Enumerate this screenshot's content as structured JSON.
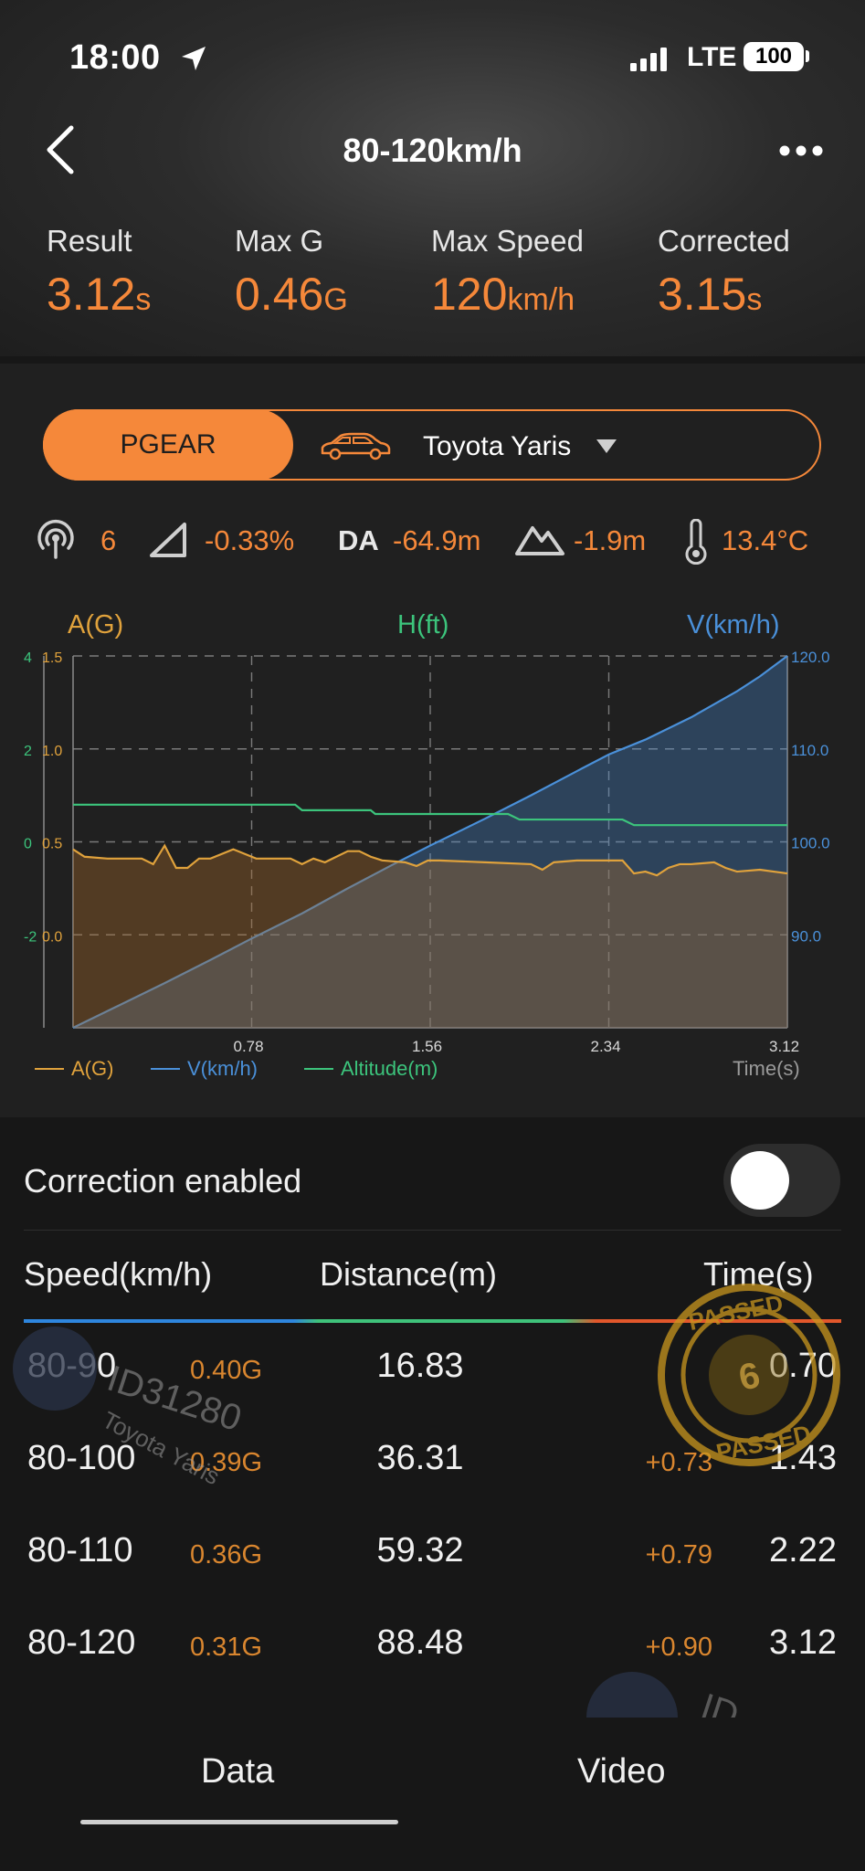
{
  "status_bar": {
    "time": "18:00",
    "network": "LTE",
    "battery": "100"
  },
  "nav": {
    "title": "80-120km/h"
  },
  "metrics": [
    {
      "label": "Result",
      "value": "3.12",
      "unit": "s"
    },
    {
      "label": "Max G",
      "value": "0.46",
      "unit": "G"
    },
    {
      "label": "Max Speed",
      "value": "120",
      "unit": "km/h"
    },
    {
      "label": "Corrected",
      "value": "3.15",
      "unit": "s"
    }
  ],
  "selector": {
    "active_tab": "PGEAR",
    "car": "Toyota Yaris"
  },
  "env": {
    "satellites": "6",
    "slope": "-0.33%",
    "da_label": "DA",
    "da": "-64.9m",
    "altitude": "-1.9m",
    "temperature": "13.4°C"
  },
  "chart_data": {
    "type": "line",
    "axis_titles": {
      "left": "A(G)",
      "middle": "H(ft)",
      "right": "V(km/h)"
    },
    "x_label": "Time(s)",
    "x_ticks": [
      "0.78",
      "1.56",
      "2.34",
      "3.12"
    ],
    "xlim": [
      0,
      3.12
    ],
    "left_ticks_h": [
      "4",
      "2",
      "0",
      "-2"
    ],
    "left_ticks_a": [
      "1.5",
      "1.0",
      "0.5",
      "0.0"
    ],
    "right_ticks": [
      "120.0",
      "110.0",
      "100.0",
      "90.0"
    ],
    "legend": [
      "A(G)",
      "V(km/h)",
      "Altitude(m)"
    ],
    "colors": {
      "accel": "#e0a23c",
      "speed": "#4a90d9",
      "altitude": "#3cc47c"
    },
    "series": [
      {
        "name": "V(km/h)",
        "axis": "right",
        "ylim": [
          80,
          120
        ],
        "x": [
          0,
          0.2,
          0.4,
          0.6,
          0.78,
          1.0,
          1.2,
          1.4,
          1.56,
          1.8,
          2.0,
          2.2,
          2.34,
          2.5,
          2.7,
          2.9,
          3.0,
          3.12
        ],
        "y": [
          80,
          82.4,
          84.8,
          87.3,
          89.6,
          92.3,
          95.0,
          97.6,
          99.6,
          102.5,
          105.0,
          107.6,
          109.4,
          111.0,
          113.4,
          116.2,
          117.8,
          120
        ]
      },
      {
        "name": "A(G)",
        "axis": "left",
        "ylim": [
          -0.5,
          1.5
        ],
        "x": [
          0,
          0.05,
          0.15,
          0.3,
          0.35,
          0.4,
          0.45,
          0.5,
          0.55,
          0.6,
          0.7,
          0.8,
          0.95,
          1.0,
          1.05,
          1.1,
          1.2,
          1.25,
          1.3,
          1.35,
          1.45,
          1.5,
          1.55,
          1.6,
          1.8,
          2.0,
          2.05,
          2.1,
          2.2,
          2.4,
          2.45,
          2.5,
          2.55,
          2.6,
          2.65,
          2.7,
          2.8,
          2.85,
          2.9,
          3.0,
          3.12
        ],
        "y": [
          0.46,
          0.42,
          0.41,
          0.41,
          0.38,
          0.48,
          0.36,
          0.36,
          0.41,
          0.41,
          0.46,
          0.41,
          0.41,
          0.38,
          0.41,
          0.39,
          0.45,
          0.45,
          0.42,
          0.4,
          0.39,
          0.37,
          0.4,
          0.4,
          0.39,
          0.38,
          0.35,
          0.39,
          0.4,
          0.4,
          0.33,
          0.34,
          0.32,
          0.36,
          0.38,
          0.38,
          0.39,
          0.36,
          0.34,
          0.35,
          0.33
        ]
      },
      {
        "name": "Altitude(m)",
        "axis": "left_h",
        "ylim": [
          -6,
          4
        ],
        "x": [
          0,
          0.97,
          1.0,
          1.3,
          1.32,
          1.9,
          1.95,
          2.4,
          2.45,
          3.12
        ],
        "y": [
          0,
          0,
          -0.15,
          -0.15,
          -0.25,
          -0.25,
          -0.4,
          -0.4,
          -0.55,
          -0.55
        ]
      }
    ]
  },
  "correction": {
    "label": "Correction enabled",
    "enabled": false
  },
  "table": {
    "headers": {
      "speed": "Speed(km/h)",
      "distance": "Distance(m)",
      "time": "Time(s)"
    },
    "rows": [
      {
        "speed": "80-90",
        "g": "0.40G",
        "distance": "16.83",
        "delta": "",
        "time": "0.70"
      },
      {
        "speed": "80-100",
        "g": "0.39G",
        "distance": "36.31",
        "delta": "+0.73",
        "time": "1.43"
      },
      {
        "speed": "80-110",
        "g": "0.36G",
        "distance": "59.32",
        "delta": "+0.79",
        "time": "2.22"
      },
      {
        "speed": "80-120",
        "g": "0.31G",
        "distance": "88.48",
        "delta": "+0.90",
        "time": "3.12"
      }
    ]
  },
  "watermark": {
    "id": "ID31280",
    "car": "Toyota Yaris",
    "stamp_text": "PASSED",
    "stamp_num": "6",
    "partial": "ID"
  },
  "tabs": [
    {
      "label": "Data"
    },
    {
      "label": "Video"
    }
  ]
}
